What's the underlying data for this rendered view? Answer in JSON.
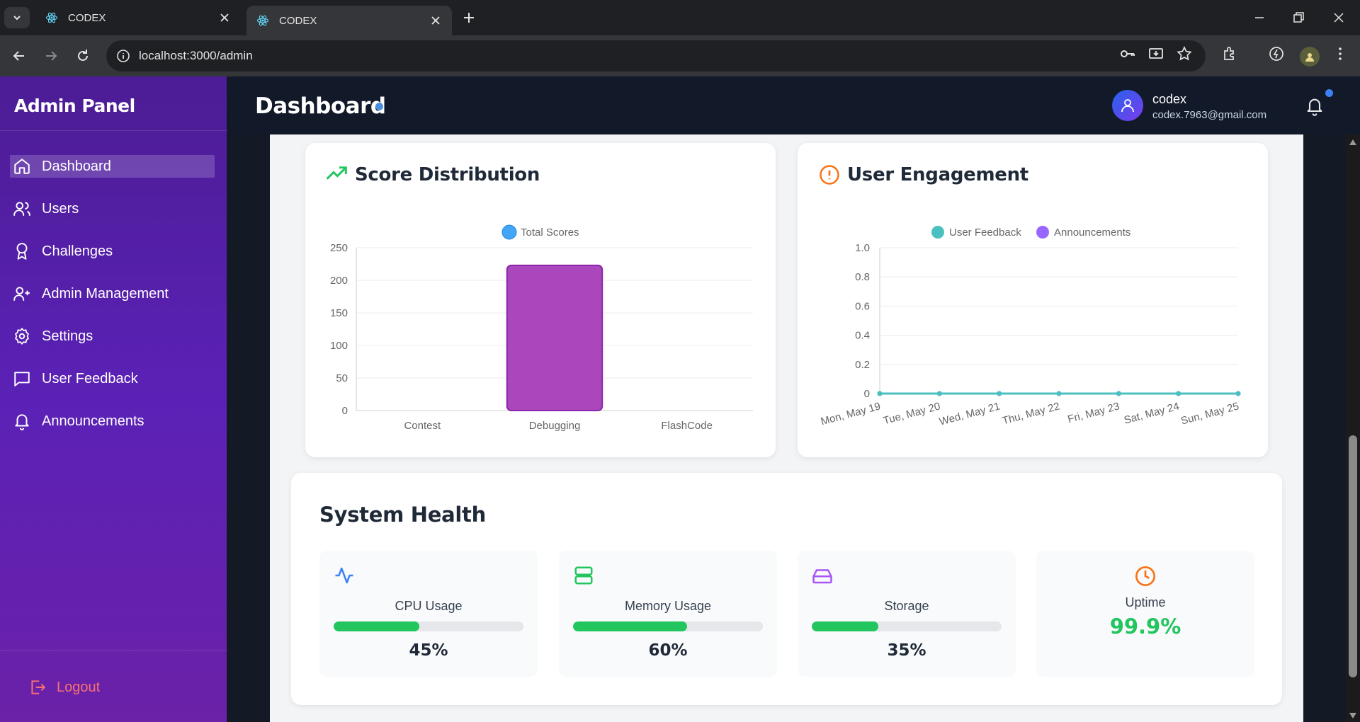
{
  "browser": {
    "tabs": [
      {
        "title": "CODEX",
        "active": false
      },
      {
        "title": "CODEX",
        "active": true
      }
    ],
    "url": "localhost:3000/admin"
  },
  "sidebar": {
    "brand": "Admin Panel",
    "items": [
      {
        "label": "Dashboard",
        "icon": "home-icon",
        "active": true
      },
      {
        "label": "Users",
        "icon": "users-icon",
        "active": false
      },
      {
        "label": "Challenges",
        "icon": "award-icon",
        "active": false
      },
      {
        "label": "Admin Management",
        "icon": "user-plus-icon",
        "active": false
      },
      {
        "label": "Settings",
        "icon": "gear-icon",
        "active": false
      },
      {
        "label": "User Feedback",
        "icon": "message-square-icon",
        "active": false
      },
      {
        "label": "Announcements",
        "icon": "bell-icon",
        "active": false
      }
    ],
    "logout_label": "Logout"
  },
  "header": {
    "title": "Dashboard",
    "user_name": "codex",
    "user_email": "codex.7963@gmail.com"
  },
  "score_distribution": {
    "title": "Score Distribution",
    "chart_data": {
      "type": "bar",
      "categories": [
        "Contest",
        "Debugging",
        "FlashCode"
      ],
      "series": [
        {
          "name": "Total Scores",
          "values": [
            0,
            223,
            0
          ]
        }
      ],
      "ylim": [
        0,
        250
      ],
      "yticks": [
        0,
        50,
        100,
        150,
        200,
        250
      ],
      "grid": true,
      "legend": "top-center",
      "colors": {
        "bar_fill": "#ab47bc",
        "bar_border": "#8e24aa",
        "legend_swatch": "#42a5f5"
      }
    }
  },
  "user_engagement": {
    "title": "User Engagement",
    "chart_data": {
      "type": "line",
      "x": [
        "Mon, May 19",
        "Tue, May 20",
        "Wed, May 21",
        "Thu, May 22",
        "Fri, May 23",
        "Sat, May 24",
        "Sun, May 25"
      ],
      "series": [
        {
          "name": "User Feedback",
          "values": [
            0,
            0,
            0,
            0,
            0,
            0,
            0
          ],
          "color": "#4bc0c0"
        },
        {
          "name": "Announcements",
          "values": [
            0,
            0,
            0,
            0,
            0,
            0,
            0
          ],
          "color": "#9966ff"
        }
      ],
      "ylim": [
        0,
        1
      ],
      "yticks": [
        "0",
        "0.2",
        "0.4",
        "0.6",
        "0.8",
        "1.0"
      ],
      "grid": true,
      "legend": "top-center"
    }
  },
  "system_health": {
    "title": "System Health",
    "metrics": [
      {
        "label": "CPU Usage",
        "value": "45%",
        "level": 45,
        "icon": "activity-icon",
        "icon_color": "#3b82f6"
      },
      {
        "label": "Memory Usage",
        "value": "60%",
        "level": 60,
        "icon": "server-icon",
        "icon_color": "#22c55e"
      },
      {
        "label": "Storage",
        "value": "35%",
        "level": 35,
        "icon": "hard-drive-icon",
        "icon_color": "#a855f7"
      },
      {
        "label": "Uptime",
        "value": "99.9%",
        "icon": "clock-icon",
        "icon_color": "#f97316"
      }
    ]
  }
}
